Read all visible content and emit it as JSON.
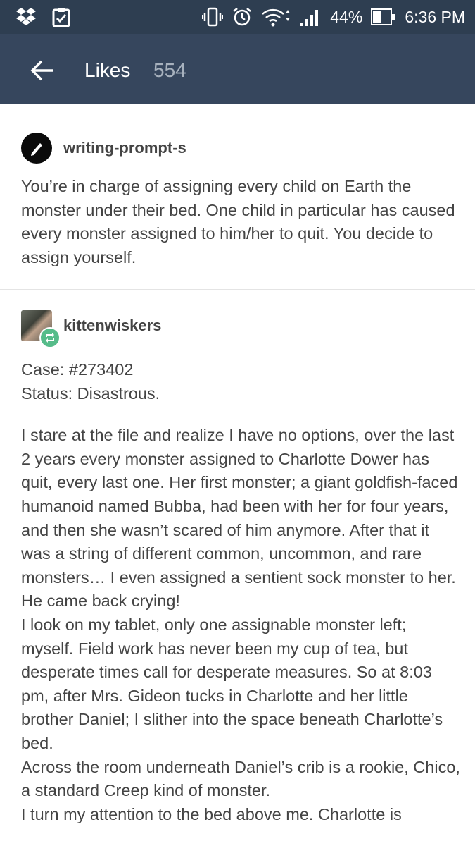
{
  "status_bar": {
    "battery_percent": "44%",
    "time": "6:36 PM",
    "left_icons": [
      "dropbox-icon",
      "clipboard-check-icon"
    ],
    "right_icons": [
      "vibrate-icon",
      "alarm-icon",
      "wifi-icon",
      "signal-icon",
      "battery-icon"
    ]
  },
  "app_bar": {
    "title": "Likes",
    "count": "554"
  },
  "post1": {
    "blog_name": "writing-prompt-s",
    "body": "You’re in charge of assigning every child on Earth the monster under their bed. One child in particular has caused every monster assigned to him/her to quit. You decide to assign yourself."
  },
  "post2": {
    "blog_name": "kittenwiskers",
    "case_line": "Case: #273402",
    "status_line": "Status: Disastrous.",
    "paragraph1": "I stare at the file and realize I have no options, over the last 2 years every monster assigned to Charlotte Dower has quit, every last one. Her first monster; a giant goldfish-faced humanoid named Bubba, had been with her for four years, and then she wasn’t scared of him anymore. After that it was a string of different common, uncommon, and rare monsters… I even assigned a sentient sock monster to her. He came back crying!",
    "paragraph2": "I look on my tablet, only one assignable monster left; myself. Field work has never been my cup of tea, but desperate times call for desperate measures. So at 8:03 pm, after Mrs. Gideon tucks in Charlotte and her little brother Daniel; I slither into the space beneath Charlotte’s bed.",
    "paragraph3": "Across the room underneath Daniel’s crib is a rookie, Chico, a standard Creep kind of monster.",
    "paragraph4": "I turn my attention to the bed above me. Charlotte is"
  },
  "colors": {
    "status_bar": "#2e3e51",
    "app_bar": "#36465d",
    "count_text": "#a7b1bd",
    "reblog_badge": "#56bc8a",
    "body_text": "#444444"
  }
}
